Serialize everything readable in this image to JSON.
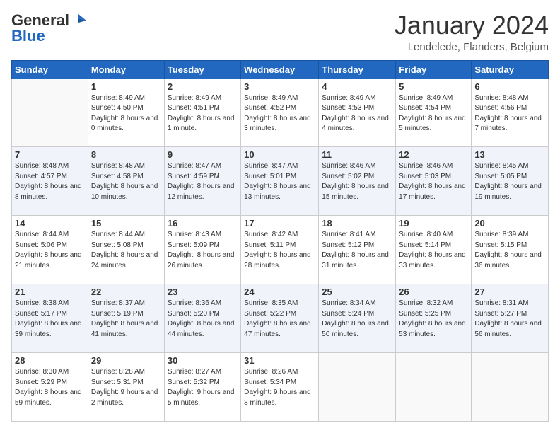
{
  "logo": {
    "line1": "General",
    "line2": "Blue"
  },
  "title": "January 2024",
  "location": "Lendelede, Flanders, Belgium",
  "days_of_week": [
    "Sunday",
    "Monday",
    "Tuesday",
    "Wednesday",
    "Thursday",
    "Friday",
    "Saturday"
  ],
  "weeks": [
    [
      {
        "day": "",
        "sunrise": "",
        "sunset": "",
        "daylight": ""
      },
      {
        "day": "1",
        "sunrise": "Sunrise: 8:49 AM",
        "sunset": "Sunset: 4:50 PM",
        "daylight": "Daylight: 8 hours and 0 minutes."
      },
      {
        "day": "2",
        "sunrise": "Sunrise: 8:49 AM",
        "sunset": "Sunset: 4:51 PM",
        "daylight": "Daylight: 8 hours and 1 minute."
      },
      {
        "day": "3",
        "sunrise": "Sunrise: 8:49 AM",
        "sunset": "Sunset: 4:52 PM",
        "daylight": "Daylight: 8 hours and 3 minutes."
      },
      {
        "day": "4",
        "sunrise": "Sunrise: 8:49 AM",
        "sunset": "Sunset: 4:53 PM",
        "daylight": "Daylight: 8 hours and 4 minutes."
      },
      {
        "day": "5",
        "sunrise": "Sunrise: 8:49 AM",
        "sunset": "Sunset: 4:54 PM",
        "daylight": "Daylight: 8 hours and 5 minutes."
      },
      {
        "day": "6",
        "sunrise": "Sunrise: 8:48 AM",
        "sunset": "Sunset: 4:56 PM",
        "daylight": "Daylight: 8 hours and 7 minutes."
      }
    ],
    [
      {
        "day": "7",
        "sunrise": "Sunrise: 8:48 AM",
        "sunset": "Sunset: 4:57 PM",
        "daylight": "Daylight: 8 hours and 8 minutes."
      },
      {
        "day": "8",
        "sunrise": "Sunrise: 8:48 AM",
        "sunset": "Sunset: 4:58 PM",
        "daylight": "Daylight: 8 hours and 10 minutes."
      },
      {
        "day": "9",
        "sunrise": "Sunrise: 8:47 AM",
        "sunset": "Sunset: 4:59 PM",
        "daylight": "Daylight: 8 hours and 12 minutes."
      },
      {
        "day": "10",
        "sunrise": "Sunrise: 8:47 AM",
        "sunset": "Sunset: 5:01 PM",
        "daylight": "Daylight: 8 hours and 13 minutes."
      },
      {
        "day": "11",
        "sunrise": "Sunrise: 8:46 AM",
        "sunset": "Sunset: 5:02 PM",
        "daylight": "Daylight: 8 hours and 15 minutes."
      },
      {
        "day": "12",
        "sunrise": "Sunrise: 8:46 AM",
        "sunset": "Sunset: 5:03 PM",
        "daylight": "Daylight: 8 hours and 17 minutes."
      },
      {
        "day": "13",
        "sunrise": "Sunrise: 8:45 AM",
        "sunset": "Sunset: 5:05 PM",
        "daylight": "Daylight: 8 hours and 19 minutes."
      }
    ],
    [
      {
        "day": "14",
        "sunrise": "Sunrise: 8:44 AM",
        "sunset": "Sunset: 5:06 PM",
        "daylight": "Daylight: 8 hours and 21 minutes."
      },
      {
        "day": "15",
        "sunrise": "Sunrise: 8:44 AM",
        "sunset": "Sunset: 5:08 PM",
        "daylight": "Daylight: 8 hours and 24 minutes."
      },
      {
        "day": "16",
        "sunrise": "Sunrise: 8:43 AM",
        "sunset": "Sunset: 5:09 PM",
        "daylight": "Daylight: 8 hours and 26 minutes."
      },
      {
        "day": "17",
        "sunrise": "Sunrise: 8:42 AM",
        "sunset": "Sunset: 5:11 PM",
        "daylight": "Daylight: 8 hours and 28 minutes."
      },
      {
        "day": "18",
        "sunrise": "Sunrise: 8:41 AM",
        "sunset": "Sunset: 5:12 PM",
        "daylight": "Daylight: 8 hours and 31 minutes."
      },
      {
        "day": "19",
        "sunrise": "Sunrise: 8:40 AM",
        "sunset": "Sunset: 5:14 PM",
        "daylight": "Daylight: 8 hours and 33 minutes."
      },
      {
        "day": "20",
        "sunrise": "Sunrise: 8:39 AM",
        "sunset": "Sunset: 5:15 PM",
        "daylight": "Daylight: 8 hours and 36 minutes."
      }
    ],
    [
      {
        "day": "21",
        "sunrise": "Sunrise: 8:38 AM",
        "sunset": "Sunset: 5:17 PM",
        "daylight": "Daylight: 8 hours and 39 minutes."
      },
      {
        "day": "22",
        "sunrise": "Sunrise: 8:37 AM",
        "sunset": "Sunset: 5:19 PM",
        "daylight": "Daylight: 8 hours and 41 minutes."
      },
      {
        "day": "23",
        "sunrise": "Sunrise: 8:36 AM",
        "sunset": "Sunset: 5:20 PM",
        "daylight": "Daylight: 8 hours and 44 minutes."
      },
      {
        "day": "24",
        "sunrise": "Sunrise: 8:35 AM",
        "sunset": "Sunset: 5:22 PM",
        "daylight": "Daylight: 8 hours and 47 minutes."
      },
      {
        "day": "25",
        "sunrise": "Sunrise: 8:34 AM",
        "sunset": "Sunset: 5:24 PM",
        "daylight": "Daylight: 8 hours and 50 minutes."
      },
      {
        "day": "26",
        "sunrise": "Sunrise: 8:32 AM",
        "sunset": "Sunset: 5:25 PM",
        "daylight": "Daylight: 8 hours and 53 minutes."
      },
      {
        "day": "27",
        "sunrise": "Sunrise: 8:31 AM",
        "sunset": "Sunset: 5:27 PM",
        "daylight": "Daylight: 8 hours and 56 minutes."
      }
    ],
    [
      {
        "day": "28",
        "sunrise": "Sunrise: 8:30 AM",
        "sunset": "Sunset: 5:29 PM",
        "daylight": "Daylight: 8 hours and 59 minutes."
      },
      {
        "day": "29",
        "sunrise": "Sunrise: 8:28 AM",
        "sunset": "Sunset: 5:31 PM",
        "daylight": "Daylight: 9 hours and 2 minutes."
      },
      {
        "day": "30",
        "sunrise": "Sunrise: 8:27 AM",
        "sunset": "Sunset: 5:32 PM",
        "daylight": "Daylight: 9 hours and 5 minutes."
      },
      {
        "day": "31",
        "sunrise": "Sunrise: 8:26 AM",
        "sunset": "Sunset: 5:34 PM",
        "daylight": "Daylight: 9 hours and 8 minutes."
      },
      {
        "day": "",
        "sunrise": "",
        "sunset": "",
        "daylight": ""
      },
      {
        "day": "",
        "sunrise": "",
        "sunset": "",
        "daylight": ""
      },
      {
        "day": "",
        "sunrise": "",
        "sunset": "",
        "daylight": ""
      }
    ]
  ]
}
